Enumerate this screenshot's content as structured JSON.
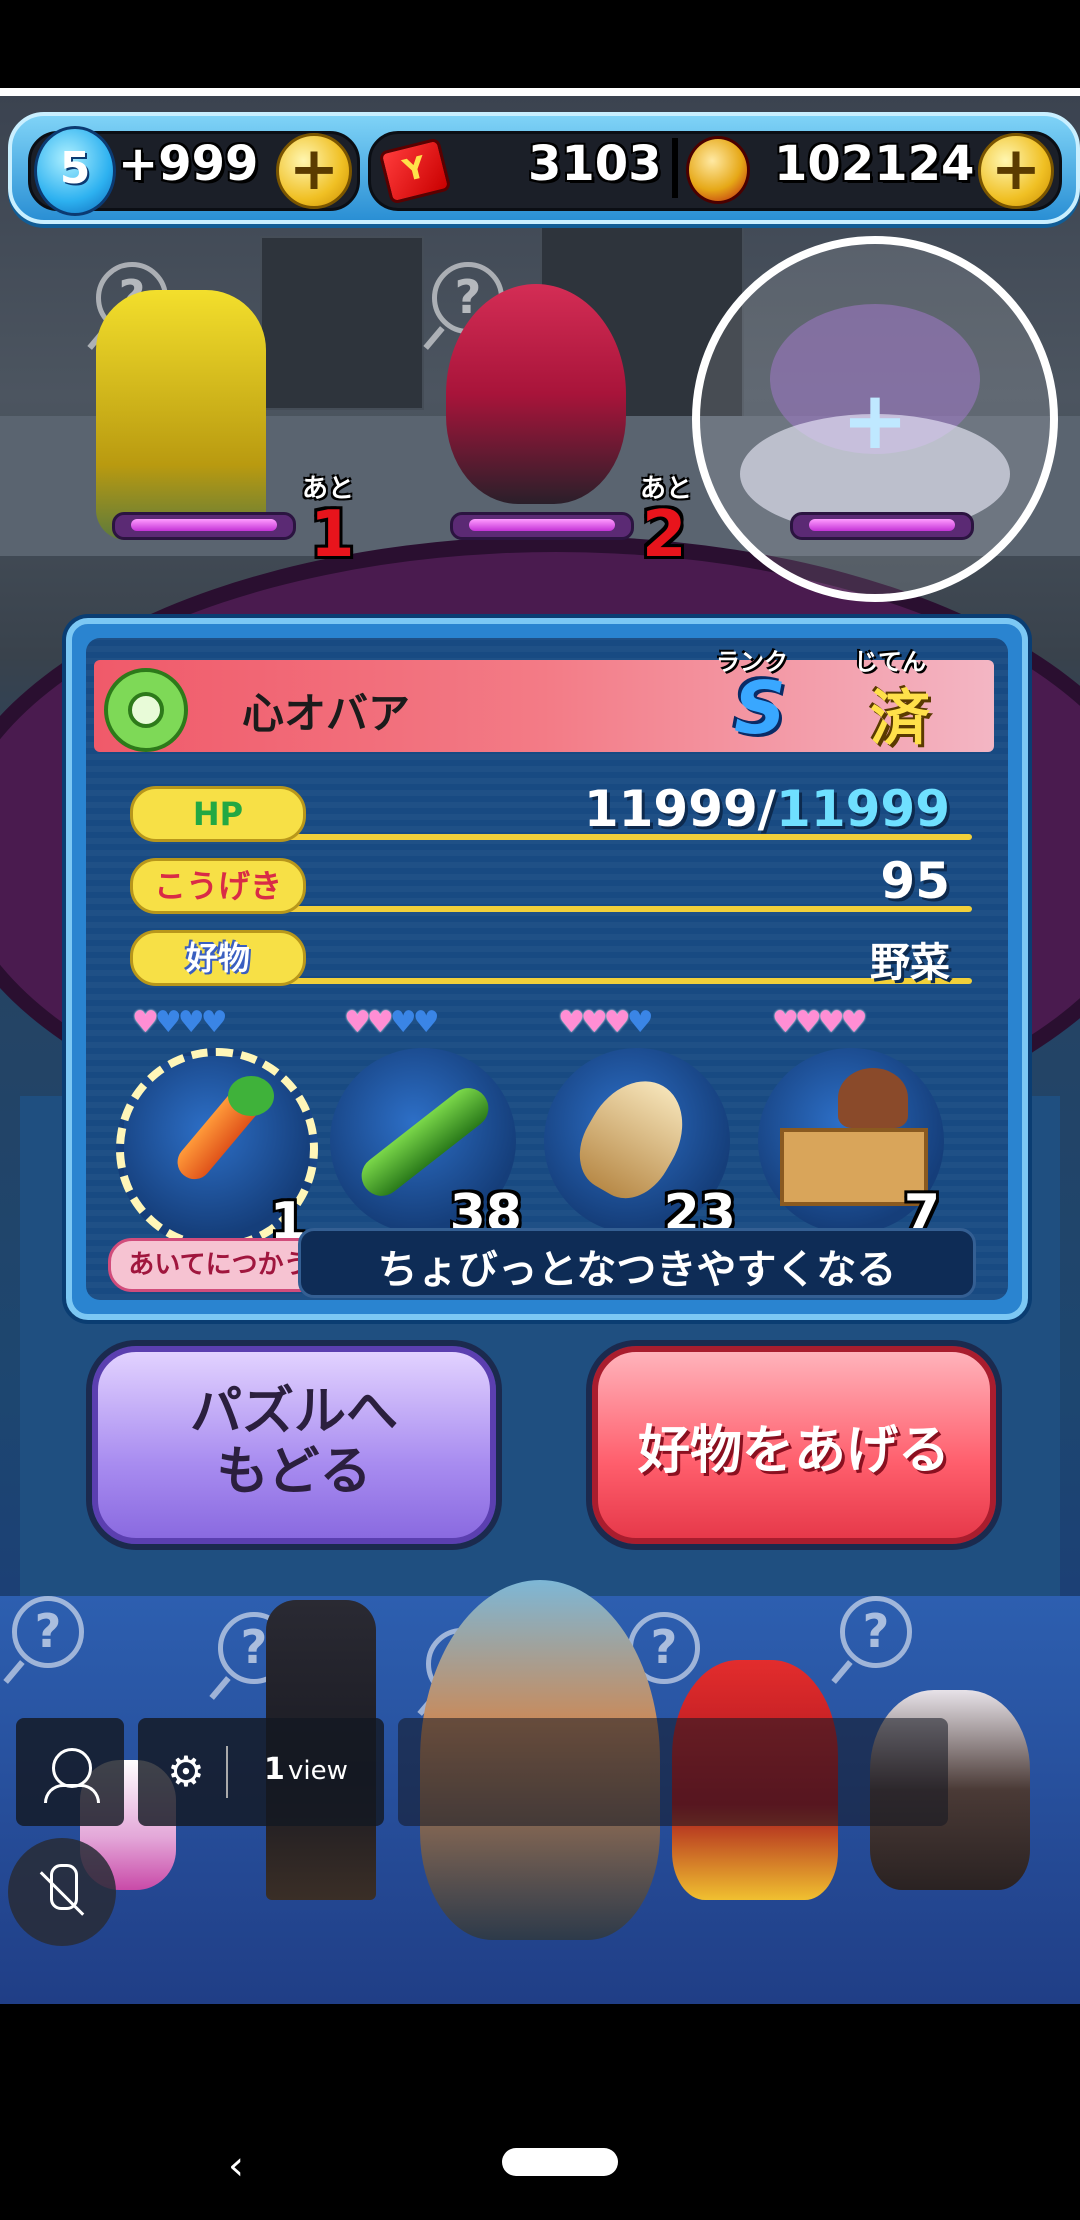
{
  "currency": {
    "stamina_level": "5",
    "stamina_amount": "+999",
    "coins": "3103",
    "money": "102124"
  },
  "top_yokai": [
    {
      "ato_label": "あと",
      "ato_count": "1"
    },
    {
      "ato_label": "あと",
      "ato_count": "2"
    }
  ],
  "empty_slot_symbol": "+",
  "question_symbol": "?",
  "info": {
    "name": "心オバア",
    "rank_label": "ランク",
    "rank_value": "S",
    "jiten_label": "じてん",
    "jiten_value": "済",
    "hp_label": "HP",
    "hp_current": "11999",
    "hp_sep": "/",
    "hp_max": "11999",
    "attack_label": "こうげき",
    "attack_value": "95",
    "favorite_label": "好物",
    "favorite_value": "野菜",
    "foods": [
      {
        "name": "carrot",
        "count": "1",
        "hearts_pink": 1,
        "hearts_blue": 3
      },
      {
        "name": "cucumber",
        "count": "38",
        "hearts_pink": 2,
        "hearts_blue": 2
      },
      {
        "name": "bamboo-shoot",
        "count": "23",
        "hearts_pink": 3,
        "hearts_blue": 1
      },
      {
        "name": "matsutake-box",
        "count": "7",
        "hearts_pink": 4,
        "hearts_blue": 0
      }
    ],
    "use_on_label": "あいてにつかう",
    "description": "ちょびっとなつきやすくなる"
  },
  "buttons": {
    "back_line1": "パズルへ",
    "back_line2": "もどる",
    "give": "好物をあげる"
  },
  "overlay": {
    "view_count": "1",
    "view_label": "view"
  },
  "colors": {
    "hp_max": "#6fe0ff",
    "name_banner": "#f05a6a",
    "stat_label": "#f7e046",
    "panel_border": "#7cc8f4"
  }
}
